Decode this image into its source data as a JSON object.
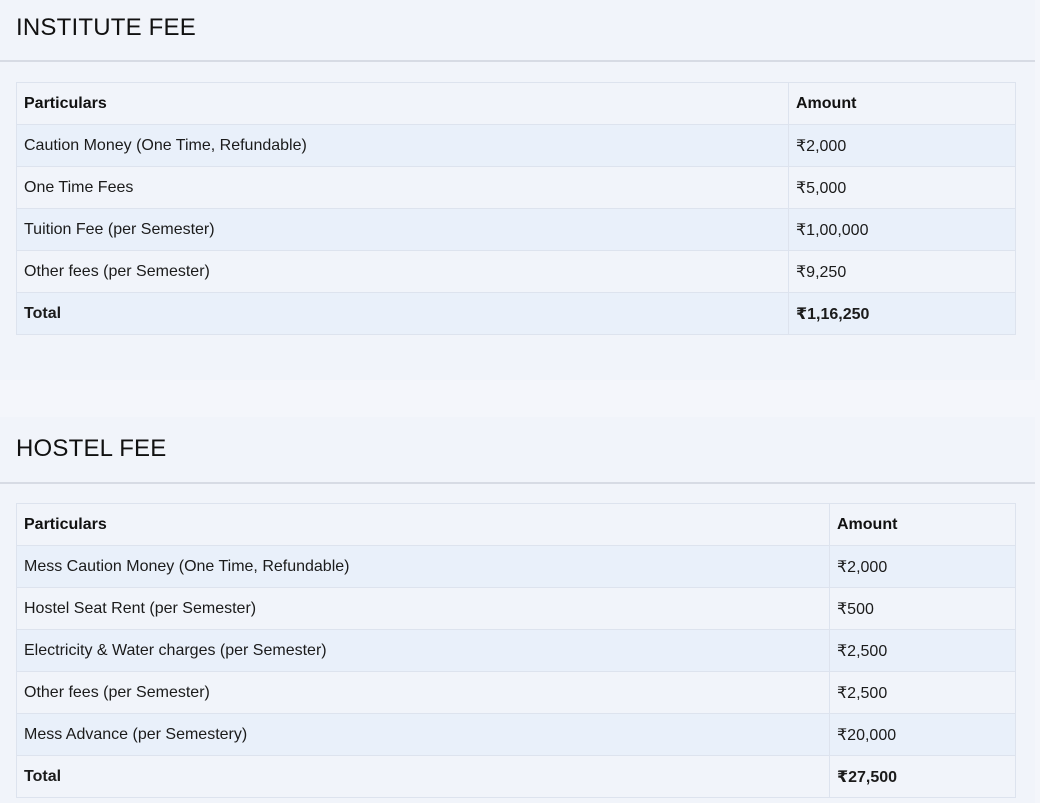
{
  "institute": {
    "title": "INSTITUTE FEE",
    "headers": {
      "particulars": "Particulars",
      "amount": "Amount"
    },
    "rows": [
      {
        "particular": "Caution Money (One Time, Refundable)",
        "amount": "₹2,000"
      },
      {
        "particular": "One Time Fees",
        "amount": "₹5,000"
      },
      {
        "particular": "Tuition Fee (per Semester)",
        "amount": "₹1,00,000"
      },
      {
        "particular": "Other fees (per Semester)",
        "amount": "₹9,250"
      }
    ],
    "total": {
      "label": "Total",
      "amount": "₹1,16,250"
    }
  },
  "hostel": {
    "title": "HOSTEL FEE",
    "headers": {
      "particulars": "Particulars",
      "amount": "Amount"
    },
    "rows": [
      {
        "particular": "Mess Caution Money (One Time, Refundable)",
        "amount": "₹2,000"
      },
      {
        "particular": "Hostel Seat Rent (per Semester)",
        "amount": "₹500"
      },
      {
        "particular": "Electricity & Water charges (per Semester)",
        "amount": "₹2,500"
      },
      {
        "particular": "Other fees (per Semester)",
        "amount": "₹2,500"
      },
      {
        "particular": "Mess Advance (per Semestery)",
        "amount": "₹20,000"
      }
    ],
    "total": {
      "label": "Total",
      "amount": "₹27,500"
    }
  }
}
